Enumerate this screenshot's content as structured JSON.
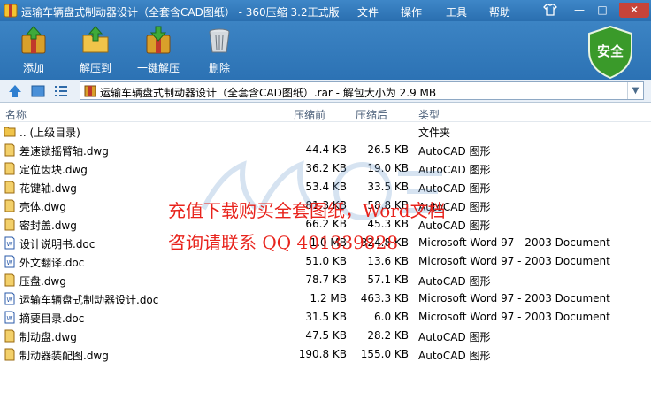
{
  "window": {
    "title": "运输车辆盘式制动器设计（全套含CAD图纸） - 360压缩 3.2正式版",
    "menus": [
      "文件",
      "操作",
      "工具",
      "帮助"
    ],
    "controls": [
      "—",
      "□",
      "✕"
    ]
  },
  "toolbar": {
    "add": "添加",
    "extract_to": "解压到",
    "one_click_extract": "一键解压",
    "delete": "删除"
  },
  "security": {
    "label": "安全"
  },
  "address": {
    "path": "运输车辆盘式制动器设计（全套含CAD图纸）.rar - 解包大小为 2.9 MB"
  },
  "columns": {
    "name": "名称",
    "packed": "压缩前",
    "original": "压缩后",
    "type": "类型"
  },
  "files": [
    {
      "name": ".. (上级目录)",
      "packed": "",
      "original": "",
      "type": "文件夹",
      "kind": "folder"
    },
    {
      "name": "差速锁摇臂轴.dwg",
      "packed": "44.4 KB",
      "original": "26.5 KB",
      "type": "AutoCAD 图形",
      "kind": "dwg"
    },
    {
      "name": "定位齿块.dwg",
      "packed": "36.2 KB",
      "original": "19.0 KB",
      "type": "AutoCAD 图形",
      "kind": "dwg"
    },
    {
      "name": "花键轴.dwg",
      "packed": "53.4 KB",
      "original": "33.5 KB",
      "type": "AutoCAD 图形",
      "kind": "dwg"
    },
    {
      "name": "壳体.dwg",
      "packed": "81.3 KB",
      "original": "58.8 KB",
      "type": "AutoCAD 图形",
      "kind": "dwg"
    },
    {
      "name": "密封盖.dwg",
      "packed": "66.2 KB",
      "original": "45.3 KB",
      "type": "AutoCAD 图形",
      "kind": "dwg"
    },
    {
      "name": "设计说明书.doc",
      "packed": "1.0 MB",
      "original": "324.8 KB",
      "type": "Microsoft Word 97 - 2003 Document",
      "kind": "doc"
    },
    {
      "name": "外文翻译.doc",
      "packed": "51.0 KB",
      "original": "13.6 KB",
      "type": "Microsoft Word 97 - 2003 Document",
      "kind": "doc"
    },
    {
      "name": "压盘.dwg",
      "packed": "78.7 KB",
      "original": "57.1 KB",
      "type": "AutoCAD 图形",
      "kind": "dwg"
    },
    {
      "name": "运输车辆盘式制动器设计.doc",
      "packed": "1.2 MB",
      "original": "463.3 KB",
      "type": "Microsoft Word 97 - 2003 Document",
      "kind": "doc"
    },
    {
      "name": "摘要目录.doc",
      "packed": "31.5 KB",
      "original": "6.0 KB",
      "type": "Microsoft Word 97 - 2003 Document",
      "kind": "doc"
    },
    {
      "name": "制动盘.dwg",
      "packed": "47.5 KB",
      "original": "28.2 KB",
      "type": "AutoCAD 图形",
      "kind": "dwg"
    },
    {
      "name": "制动器装配图.dwg",
      "packed": "190.8 KB",
      "original": "155.0 KB",
      "type": "AutoCAD 图形",
      "kind": "dwg"
    }
  ],
  "watermark": {
    "line1": "充值下载购买全套图纸，Word文档",
    "line2": "咨询请联系  QQ 401339828"
  },
  "colors": {
    "title_bar": "#2f78b9",
    "watermark_text": "#e8231c",
    "shield": "#3a9a2a"
  }
}
